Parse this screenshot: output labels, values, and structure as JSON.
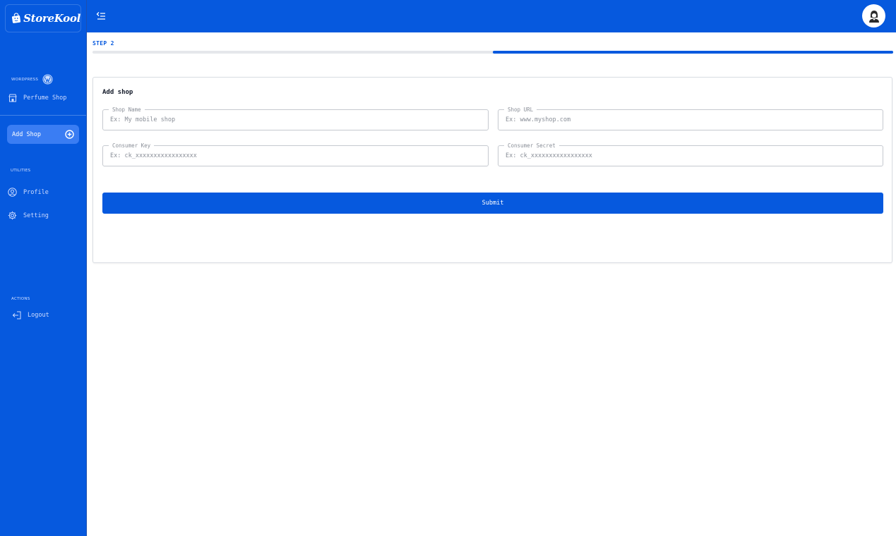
{
  "sidebar": {
    "logo_text": "StoreKool",
    "sections": {
      "wordpress": "WORDPRESS",
      "utilities": "UTILITIES",
      "actions": "ACTIONS"
    },
    "shops": [
      {
        "label": "Perfume Shop",
        "icon": "store-icon"
      }
    ],
    "add_shop": {
      "label": "Add Shop",
      "icon": "plus-circle-icon"
    },
    "utilities": [
      {
        "label": "Profile",
        "icon": "user-circle-icon"
      },
      {
        "label": "Setting",
        "icon": "gear-icon"
      }
    ],
    "actions": [
      {
        "label": "Logout",
        "icon": "logout-icon"
      }
    ]
  },
  "header": {
    "menu_icon": "menu-toggle-icon",
    "avatar_icon": "user-avatar-icon"
  },
  "steps": {
    "label": "STEP 2",
    "current": 2,
    "total": 2
  },
  "form": {
    "title": "Add shop",
    "fields": {
      "shop_name": {
        "label": "Shop Name",
        "placeholder": "Ex: My mobile shop",
        "value": ""
      },
      "shop_url": {
        "label": "Shop URL",
        "placeholder": "Ex: www.myshop.com",
        "value": ""
      },
      "consumer_key": {
        "label": "Consumer Key",
        "placeholder": "Ex: ck_xxxxxxxxxxxxxxxxx",
        "value": ""
      },
      "consumer_secret": {
        "label": "Consumer Secret",
        "placeholder": "Ex: ck_xxxxxxxxxxxxxxxxx",
        "value": ""
      }
    },
    "submit_label": "Submit"
  },
  "colors": {
    "primary": "#0659de",
    "active_item": "#3a7df3",
    "track": "#e5e7eb"
  }
}
